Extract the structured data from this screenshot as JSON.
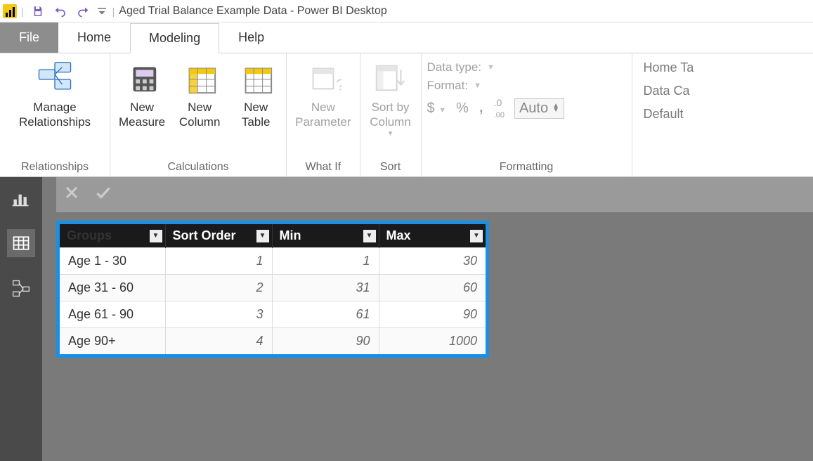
{
  "titlebar": {
    "title": "Aged Trial Balance Example Data - Power BI Desktop"
  },
  "tabs": {
    "file": "File",
    "home": "Home",
    "modeling": "Modeling",
    "help": "Help"
  },
  "ribbon": {
    "relationships": {
      "manage_btn": "Manage\nRelationships",
      "group_label": "Relationships"
    },
    "calculations": {
      "new_measure": "New\nMeasure",
      "new_column": "New\nColumn",
      "new_table": "New\nTable",
      "group_label": "Calculations"
    },
    "whatif": {
      "new_parameter": "New\nParameter",
      "group_label": "What If"
    },
    "sort": {
      "sort_by_column": "Sort by\nColumn",
      "group_label": "Sort"
    },
    "formatting": {
      "data_type_label": "Data type:",
      "format_label": "Format:",
      "currency": "$",
      "percent": "%",
      "comma": ",",
      "decimal_icon": ".00",
      "auto": "Auto",
      "group_label": "Formatting"
    },
    "properties": {
      "home_table": "Home Ta",
      "data_category": "Data Ca",
      "default": "Default"
    }
  },
  "table": {
    "headers": [
      "Groups",
      "Sort Order",
      "Min",
      "Max"
    ],
    "rows": [
      {
        "group": "Age 1 - 30",
        "sort": "1",
        "min": "1",
        "max": "30"
      },
      {
        "group": "Age 31 - 60",
        "sort": "2",
        "min": "31",
        "max": "60"
      },
      {
        "group": "Age 61 - 90",
        "sort": "3",
        "min": "61",
        "max": "90"
      },
      {
        "group": "Age 90+",
        "sort": "4",
        "min": "90",
        "max": "1000"
      }
    ]
  }
}
